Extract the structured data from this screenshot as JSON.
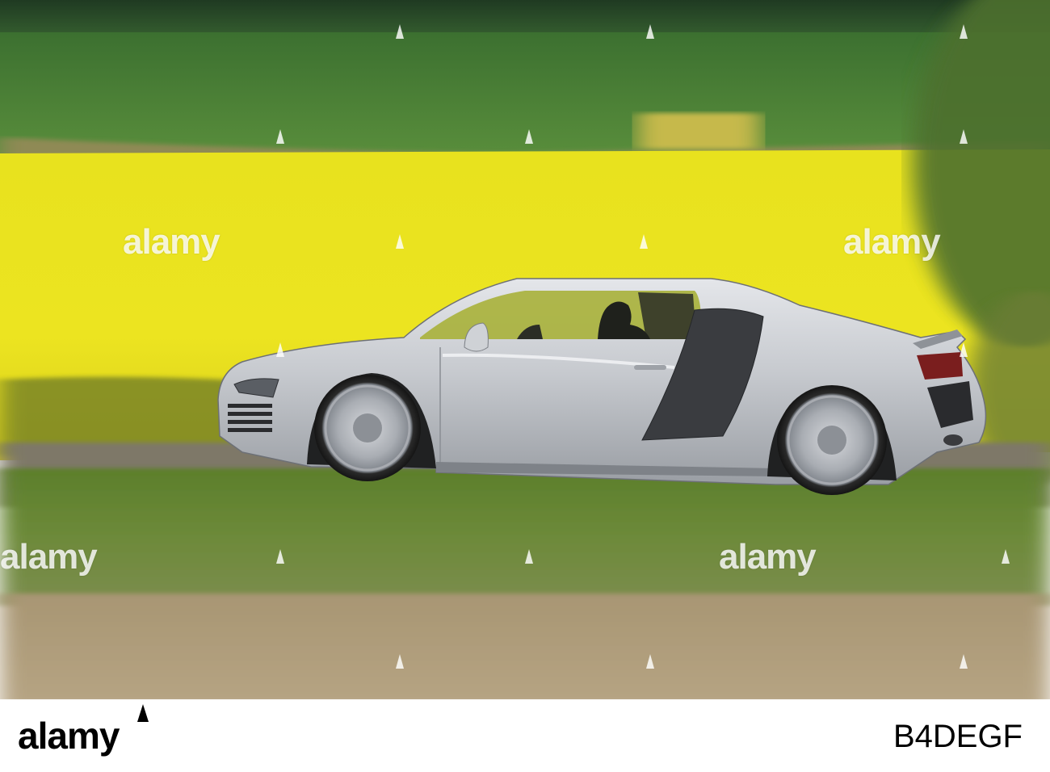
{
  "photo": {
    "subject": "silver-sports-car",
    "watermark_text": "alamy"
  },
  "footer": {
    "brand": "alamy",
    "image_id": "B4DEGF"
  },
  "colors": {
    "rapeseed_yellow": "#e6e21a",
    "field_green": "#3f7a2f",
    "car_silver": "#c9ccd0",
    "road_grey": "#8c8478"
  }
}
